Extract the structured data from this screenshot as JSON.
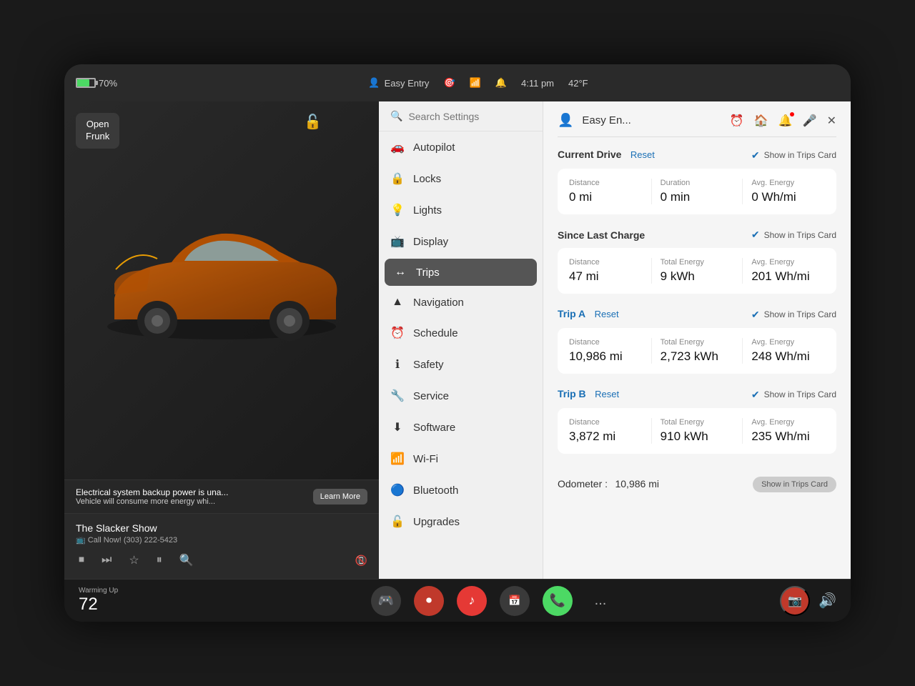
{
  "statusBar": {
    "battery": "70%",
    "userIcon": "👤",
    "profileName": "Easy Entry",
    "time": "4:11 pm",
    "temperature": "42°F",
    "icons": [
      "🎯",
      "📶",
      "🔔"
    ]
  },
  "leftPanel": {
    "openFrunk": "Open\nFrunk",
    "alert": {
      "title": "Electrical system backup power is una...",
      "subtitle": "Vehicle will consume more energy whi...",
      "learnMore": "Learn More"
    },
    "media": {
      "title": "The Slacker Show",
      "subtitle": "📺 Call Now! (303) 222-5423"
    }
  },
  "sidebar": {
    "searchPlaceholder": "Search Settings",
    "items": [
      {
        "label": "Autopilot",
        "icon": "🚗"
      },
      {
        "label": "Locks",
        "icon": "🔒"
      },
      {
        "label": "Lights",
        "icon": "💡"
      },
      {
        "label": "Display",
        "icon": "📺"
      },
      {
        "label": "Trips",
        "icon": "🗺",
        "active": true
      },
      {
        "label": "Navigation",
        "icon": "▲"
      },
      {
        "label": "Schedule",
        "icon": "⏰"
      },
      {
        "label": "Safety",
        "icon": "ℹ"
      },
      {
        "label": "Service",
        "icon": "🔧"
      },
      {
        "label": "Software",
        "icon": "⬇"
      },
      {
        "label": "Wi-Fi",
        "icon": "📶"
      },
      {
        "label": "Bluetooth",
        "icon": "🔵"
      },
      {
        "label": "Upgrades",
        "icon": "🔓"
      }
    ]
  },
  "tripsPanel": {
    "profileName": "Easy En...",
    "currentDrive": {
      "title": "Current Drive",
      "reset": "Reset",
      "showInTrips": "Show in Trips Card",
      "distance": {
        "label": "Distance",
        "value": "0 mi"
      },
      "duration": {
        "label": "Duration",
        "value": "0 min"
      },
      "avgEnergy": {
        "label": "Avg. Energy",
        "value": "0 Wh/mi"
      }
    },
    "sinceLastCharge": {
      "title": "Since Last Charge",
      "showInTrips": "Show in Trips Card",
      "distance": {
        "label": "Distance",
        "value": "47 mi"
      },
      "totalEnergy": {
        "label": "Total Energy",
        "value": "9 kWh"
      },
      "avgEnergy": {
        "label": "Avg. Energy",
        "value": "201 Wh/mi"
      }
    },
    "tripA": {
      "title": "Trip A",
      "reset": "Reset",
      "showInTrips": "Show in Trips Card",
      "distance": {
        "label": "Distance",
        "value": "10,986 mi"
      },
      "totalEnergy": {
        "label": "Total Energy",
        "value": "2,723 kWh"
      },
      "avgEnergy": {
        "label": "Avg. Energy",
        "value": "248 Wh/mi"
      }
    },
    "tripB": {
      "title": "Trip B",
      "reset": "Reset",
      "showInTrips": "Show in Trips Card",
      "distance": {
        "label": "Distance",
        "value": "3,872 mi"
      },
      "totalEnergy": {
        "label": "Total Energy",
        "value": "910 kWh"
      },
      "avgEnergy": {
        "label": "Avg. Energy",
        "value": "235 Wh/mi"
      }
    },
    "odometer": {
      "label": "Odometer :",
      "value": "10,986 mi",
      "showInTrips": "Show in Trips Card"
    }
  },
  "taskbar": {
    "warmingLabel": "Warming Up",
    "temperature": "72",
    "moreLabel": "..."
  }
}
